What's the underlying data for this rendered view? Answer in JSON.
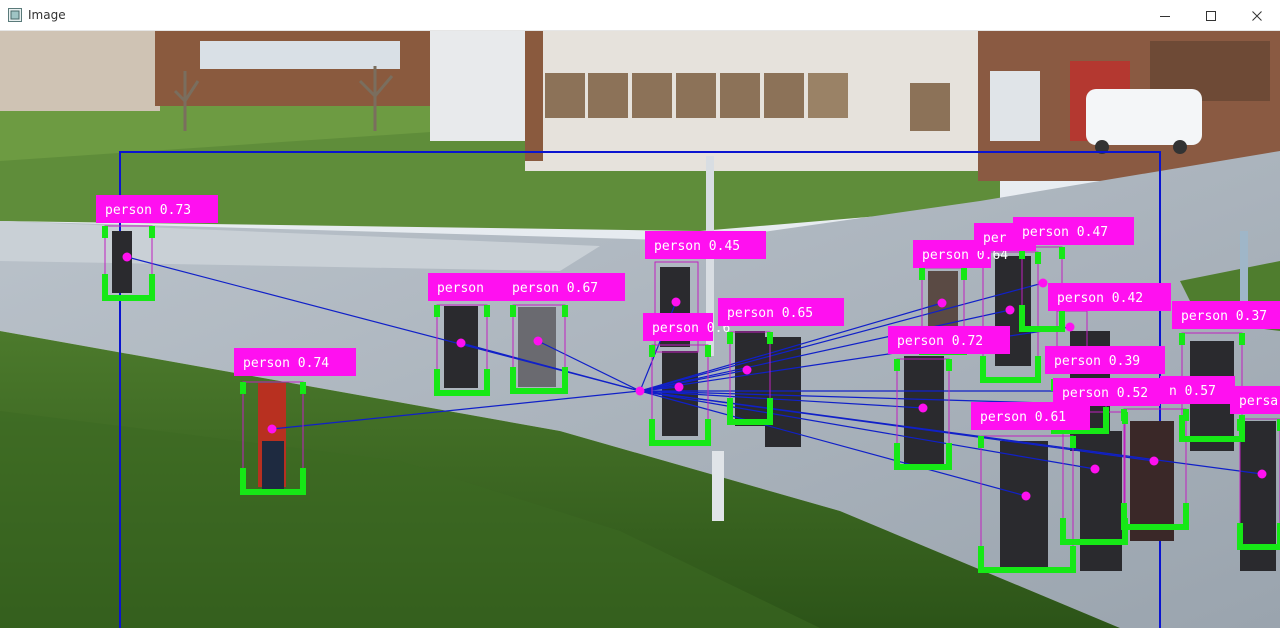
{
  "window": {
    "title": "Image",
    "icon": "image-window-icon",
    "controls": [
      "minimize-icon",
      "maximize-icon",
      "close-icon"
    ]
  },
  "colors": {
    "label_bg": "#ff10f0",
    "label_text": "#ffffff",
    "bracket": "#16e816",
    "box": "#c020c0",
    "roi": "#0a14d0",
    "line": "#1020c8"
  },
  "detections": [
    {
      "label": "person 0.73"
    },
    {
      "label": "person 0.74"
    },
    {
      "label": "person"
    },
    {
      "label": "person 0.67"
    },
    {
      "label": "person 0.45"
    },
    {
      "label": "person 0.6"
    },
    {
      "label": "person 0.65"
    },
    {
      "label": "person 0.64"
    },
    {
      "label": "per"
    },
    {
      "label": "person 0.47"
    },
    {
      "label": "person 0.42"
    },
    {
      "label": "person 0.72"
    },
    {
      "label": "person 0.39"
    },
    {
      "label": "person 0.52"
    },
    {
      "label": "n 0.57"
    },
    {
      "label": "person 0.37"
    },
    {
      "label": "persa"
    },
    {
      "label": "person 0.61"
    }
  ]
}
